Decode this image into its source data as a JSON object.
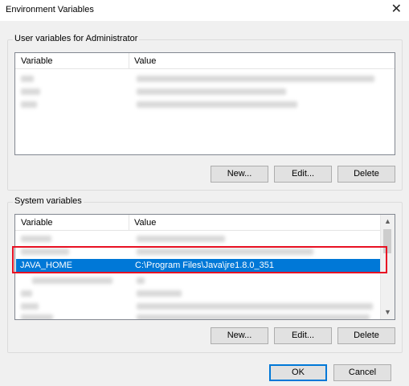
{
  "window": {
    "title": "Environment Variables",
    "close_glyph": "✕"
  },
  "user_vars": {
    "legend": "User variables for Administrator",
    "columns": {
      "variable": "Variable",
      "value": "Value"
    },
    "buttons": {
      "new": "New...",
      "edit": "Edit...",
      "delete": "Delete"
    }
  },
  "system_vars": {
    "legend": "System variables",
    "columns": {
      "variable": "Variable",
      "value": "Value"
    },
    "selected_row": {
      "variable": "JAVA_HOME",
      "value": "C:\\Program Files\\Java\\jre1.8.0_351"
    },
    "buttons": {
      "new": "New...",
      "edit": "Edit...",
      "delete": "Delete"
    }
  },
  "dialog_buttons": {
    "ok": "OK",
    "cancel": "Cancel"
  },
  "colors": {
    "selection": "#0078d7",
    "highlight": "#e81123"
  },
  "icons": {
    "scroll_up": "▲",
    "scroll_down": "▼"
  }
}
